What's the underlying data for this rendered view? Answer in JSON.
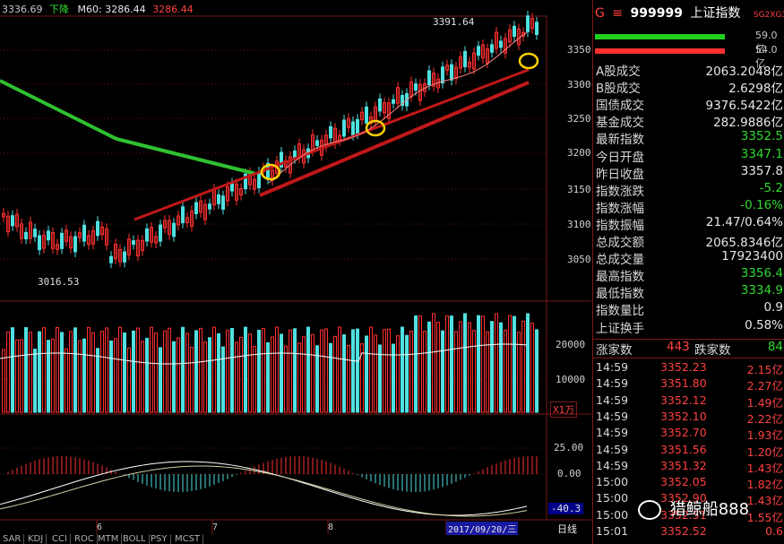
{
  "header": {
    "ma_value": "3336.69",
    "trend_label": "下降",
    "m60_label": "M60: 3286.44",
    "m60_value2": "3286.44"
  },
  "price_axis": [
    "3350",
    "3300",
    "3250",
    "3200",
    "3150",
    "3100",
    "3050"
  ],
  "volume_axis": [
    "20000",
    "10000"
  ],
  "volume_unit": "X1万",
  "macd_axis": [
    "25.00",
    "0.00",
    "-40.3"
  ],
  "annotations": {
    "high": "3391.64",
    "low": "3016.53"
  },
  "month_labels": [
    "6",
    "7",
    "8"
  ],
  "date_label": "2017/09/20/三",
  "period_label": "日线",
  "indicator_tabs": [
    "SAR",
    "KDJ",
    "CCI",
    "ROC",
    "MTM",
    "BOLL",
    "PSY",
    "MCST"
  ],
  "panel": {
    "code": "999999",
    "name": "上证指数",
    "flag": "G",
    "tag": "SG2XG3",
    "bar_values": [
      "59.0亿",
      "54.0亿"
    ],
    "stats": [
      {
        "label": "A股成交",
        "value": "2063.2048亿",
        "color": "white"
      },
      {
        "label": "B股成交",
        "value": "2.6298亿",
        "color": "white"
      },
      {
        "label": "国债成交",
        "value": "9376.5422亿",
        "color": "white"
      },
      {
        "label": "基金成交",
        "value": "282.9886亿",
        "color": "white"
      },
      {
        "label": "最新指数",
        "value": "3352.5",
        "color": "green"
      },
      {
        "label": "今日开盘",
        "value": "3347.1",
        "color": "green"
      },
      {
        "label": "昨日收盘",
        "value": "3357.8",
        "color": "white"
      },
      {
        "label": "指数涨跌",
        "value": "-5.2",
        "color": "green"
      },
      {
        "label": "指数涨幅",
        "value": "-0.16%",
        "color": "green"
      },
      {
        "label": "指数振幅",
        "value": "21.47/0.64%",
        "color": "white"
      },
      {
        "label": "总成交额",
        "value": "2065.8346亿",
        "color": "white"
      },
      {
        "label": "总成交量",
        "value": "17923400",
        "color": "white"
      },
      {
        "label": "最高指数",
        "value": "3356.4",
        "color": "green"
      },
      {
        "label": "最低指数",
        "value": "3334.9",
        "color": "green"
      },
      {
        "label": "指数量比",
        "value": "0.9",
        "color": "white"
      },
      {
        "label": "上证换手",
        "value": "0.58%",
        "color": "white"
      }
    ],
    "rise_label": "涨家数",
    "rise_count": "443",
    "fall_label": "跌家数",
    "fall_count": "84",
    "ticks": [
      {
        "time": "14:59",
        "price": "3352.23",
        "vol": "2.15亿"
      },
      {
        "time": "14:59",
        "price": "3351.80",
        "vol": "2.27亿"
      },
      {
        "time": "14:59",
        "price": "3352.12",
        "vol": "1.49亿"
      },
      {
        "time": "14:59",
        "price": "3352.10",
        "vol": "2.22亿"
      },
      {
        "time": "14:59",
        "price": "3352.70",
        "vol": "1.93亿"
      },
      {
        "time": "14:59",
        "price": "3351.56",
        "vol": "1.20亿"
      },
      {
        "time": "14:59",
        "price": "3351.32",
        "vol": "1.43亿"
      },
      {
        "time": "15:00",
        "price": "3352.05",
        "vol": "1.82亿"
      },
      {
        "time": "15:00",
        "price": "3352.90",
        "vol": "1.43亿"
      },
      {
        "time": "15:00",
        "price": "3352.51",
        "vol": "1.55亿"
      },
      {
        "time": "15:01",
        "price": "3352.52",
        "vol": "0.6"
      }
    ]
  },
  "watermark": "猎鲸船888",
  "colors": {
    "up": "#ff3030",
    "down": "#50e0e0",
    "ma_green": "#30c030",
    "ma_red": "#c01818"
  }
}
